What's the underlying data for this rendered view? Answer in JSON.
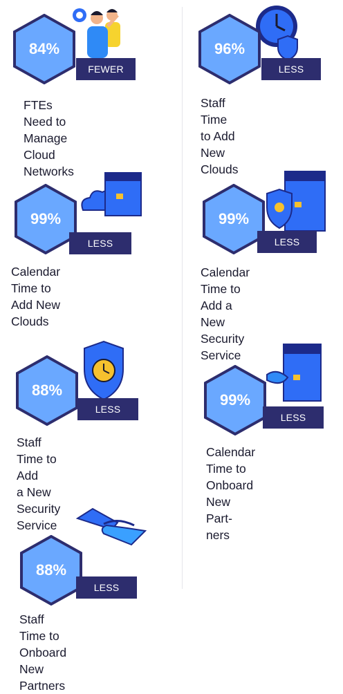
{
  "stats": [
    {
      "percent": "84%",
      "qualifier": "FEWER",
      "lines": [
        "FTEs Need to Manage",
        "Cloud Networks"
      ]
    },
    {
      "percent": "96%",
      "qualifier": "LESS",
      "lines": [
        "Staff Time to Add",
        "New Clouds"
      ]
    },
    {
      "percent": "99%",
      "qualifier": "LESS",
      "lines": [
        "Calendar Time to",
        "Add New Clouds"
      ]
    },
    {
      "percent": "99%",
      "qualifier": "LESS",
      "lines": [
        "Calendar Time to",
        "Add a New Security",
        "Service"
      ]
    },
    {
      "percent": "88%",
      "qualifier": "LESS",
      "lines": [
        "Staff Time to Add",
        "a New Security",
        "Service"
      ]
    },
    {
      "percent": "99%",
      "qualifier": "LESS",
      "lines": [
        "Calendar Time to",
        "Onboard New Part-",
        "ners"
      ]
    },
    {
      "percent": "88%",
      "qualifier": "LESS",
      "lines": [
        "Staff Time to Onboard",
        "New Partners"
      ]
    }
  ],
  "colors": {
    "hexagon_fill": "#6aa8ff",
    "hexagon_stroke": "#2d2d6e",
    "badge": "#2d2d6e",
    "illustration_blue": "#2f6df6"
  }
}
